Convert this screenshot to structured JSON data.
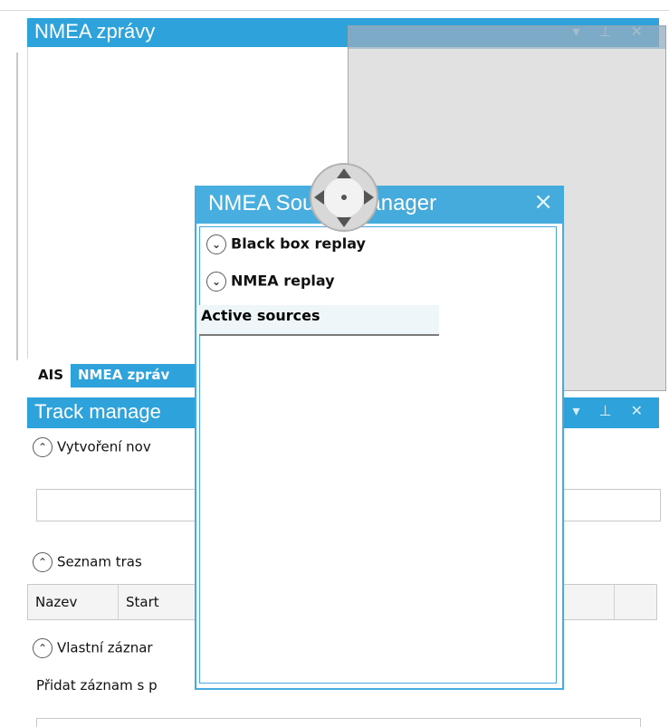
{
  "nmea_panel": {
    "title": "NMEA zprávy",
    "controls": "▾ ⊥ ✕"
  },
  "tabs": [
    {
      "label": "AIS"
    },
    {
      "label": "NMEA zpráv"
    }
  ],
  "track_panel": {
    "title": "Track manage",
    "controls": "▾ ⊥ ✕",
    "section_create": "Vytvoření nov",
    "section_list": "Seznam tras",
    "columns": [
      "Nazev",
      "Start"
    ],
    "section_custom": "Vlastní záznar",
    "add_note": "Přidat záznam s p"
  },
  "source_manager": {
    "title": "NMEA Source Manager",
    "close": "×",
    "sections": [
      "Black box replay",
      "NMEA replay"
    ],
    "active_sources": "Active sources"
  },
  "colors": {
    "accent": "#2ea3db"
  },
  "icons": {
    "chevron_down": "⌄",
    "chevron_up": "⌃"
  }
}
